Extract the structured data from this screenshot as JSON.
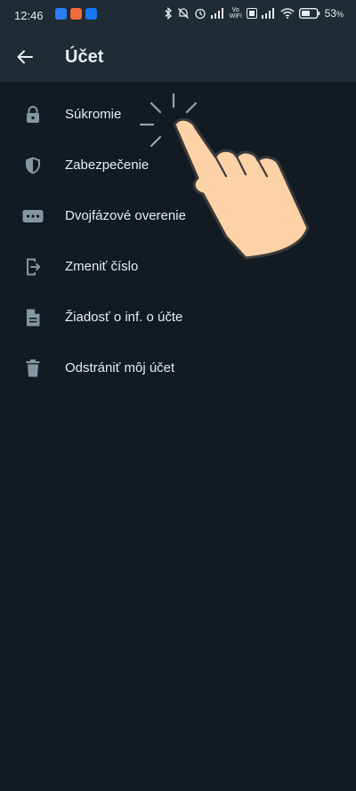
{
  "status_bar": {
    "time": "12:46",
    "battery_percent": "53",
    "battery_unit": "%",
    "vowifi_top": "Vo",
    "vowifi_bottom": "WiFi",
    "notification_icons": [
      "messenger-icon",
      "shopping-icon",
      "facebook-icon"
    ],
    "indicator_icons": [
      "bluetooth-icon",
      "bell-off-icon",
      "alarm-icon",
      "signal-icon",
      "vowifi-icon",
      "volte-icon",
      "signal-icon",
      "wifi-icon",
      "battery-icon"
    ]
  },
  "app_bar": {
    "back_icon": "arrow-left-icon",
    "title": "Účet"
  },
  "menu": {
    "items": [
      {
        "label": "Súkromie",
        "icon": "lock-icon"
      },
      {
        "label": "Zabezpečenie",
        "icon": "shield-icon"
      },
      {
        "label": "Dvojfázové overenie",
        "icon": "dots-icon"
      },
      {
        "label": "Zmeniť číslo",
        "icon": "change-number-icon"
      },
      {
        "label": "Žiadosť o inf. o účte",
        "icon": "document-icon"
      },
      {
        "label": "Odstrániť môj účet",
        "icon": "trash-icon"
      }
    ]
  },
  "overlay": {
    "icon": "tap-hand-icon"
  },
  "colors": {
    "background": "#111b21",
    "app_bar": "#1f2c34",
    "text_primary": "#e9edef",
    "icon": "#8696a0",
    "hand_fill": "#fdd2a7",
    "hand_stroke": "#3a3a3a"
  }
}
